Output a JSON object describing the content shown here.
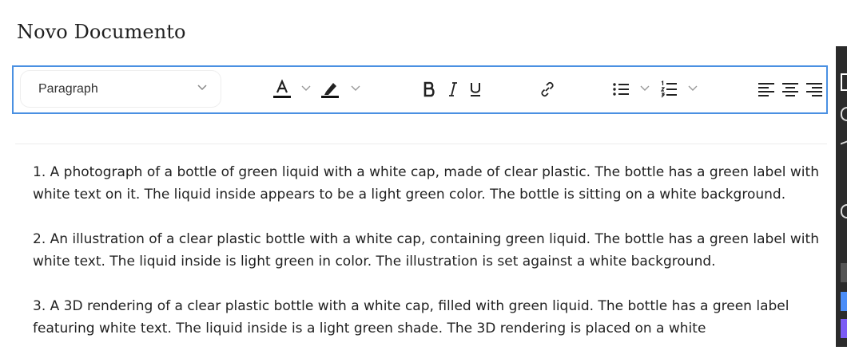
{
  "document": {
    "title": "Novo Documento"
  },
  "toolbar": {
    "block_type": "Paragraph"
  },
  "icons": {
    "text_color": "text-color-icon",
    "highlight": "highlight-icon",
    "bold": "bold-icon",
    "italic": "italic-icon",
    "underline": "underline-icon",
    "link": "link-icon",
    "bullet_list": "bullet-list-icon",
    "numbered_list": "numbered-list-icon",
    "align_left": "align-left-icon",
    "align_center": "align-center-icon",
    "align_right": "align-right-icon"
  },
  "content": {
    "paragraphs": [
      "1. A photograph of a bottle of green liquid with a white cap, made of clear plastic. The bottle has a green label with white text on it. The liquid inside appears to be a light green color. The bottle is sitting on a white background.",
      "2. An illustration of a clear plastic bottle with a white cap, containing green liquid. The bottle has a green label with white text. The liquid inside is light green in color. The illustration is set against a white background.",
      "3. A 3D rendering of a clear plastic bottle with a white cap, filled with green liquid. The bottle has a green label featuring white text. The liquid inside is a light green shade. The 3D rendering is placed on a white"
    ]
  },
  "colors": {
    "focus_border": "#4a90e2",
    "side_panel": "#2b2b2b",
    "side_accent_blue": "#4a8df8",
    "side_accent_purple": "#7b5cf5"
  }
}
